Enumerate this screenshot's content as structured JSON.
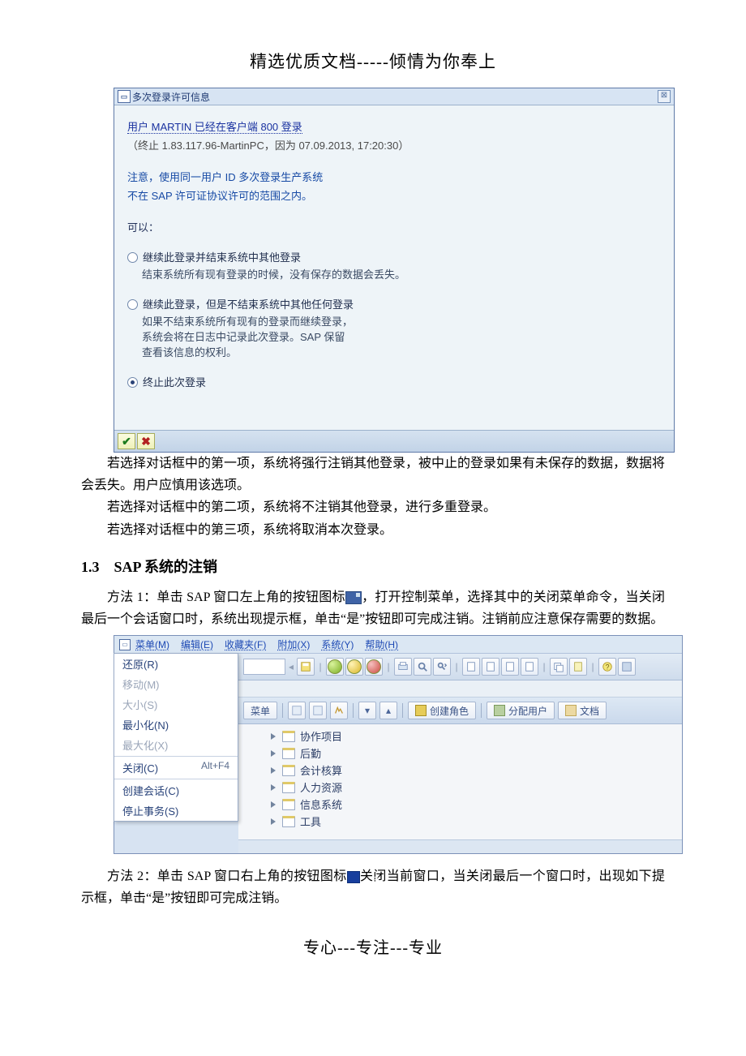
{
  "page_header": "精选优质文档-----倾情为你奉上",
  "page_footer": "专心---专注---专业",
  "dialog": {
    "title": "多次登录许可信息",
    "close_glyph": "⊠",
    "user_line_prefix": "用户 ",
    "user_name": "MARTIN",
    "user_line_mid": " 已经在客户端 ",
    "user_client": "800",
    "user_line_suffix": " 登录",
    "terminal_line": "（终止 1.83.117.96-MartinPC，因为 07.09.2013, 17:20:30）",
    "note1": "注意，使用同一用户 ID 多次登录生产系统",
    "note2": "不在 SAP 许可证协议许可的范围之内。",
    "can_label": "可以：",
    "option1": {
      "label": "继续此登录并结束系统中其他登录",
      "desc": "结束系统所有现有登录的时候，没有保存的数据会丢失。"
    },
    "option2": {
      "label": "继续此登录，但是不结束系统中其他任何登录",
      "desc1": "如果不结束系统所有现有的登录而继续登录，",
      "desc2": "系统会将在日志中记录此次登录。SAP 保留",
      "desc3": "查看该信息的权利。"
    },
    "option3": {
      "label": "终止此次登录"
    },
    "ok_glyph": "✔",
    "cancel_glyph": "✖"
  },
  "paras": {
    "p1": "若选择对话框中的第一项，系统将强行注销其他登录，被中止的登录如果有未保存的数据，数据将会丢失。用户应慎用该选项。",
    "p2": "若选择对话框中的第二项，系统将不注销其他登录，进行多重登录。",
    "p3": "若选择对话框中的第三项，系统将取消本次登录。",
    "h13": "1.3 SAP 系统的注销",
    "p4a": "方法 1：单击 SAP 窗口左上角的按钮图标",
    "p4b": "，打开控制菜单，选择其中的关闭菜单命令，当关闭最后一个会话窗口时，系统出现提示框，单击“是”按钮即可完成注销。注销前应注意保存需要的数据。",
    "p5a": "方法 2：单击 SAP 窗口右上角的按钮图标",
    "p5b": "关闭当前窗口，当关闭最后一个窗口时，出现如下提示框，单击“是”按钮即可完成注销。"
  },
  "sap_window": {
    "menubar": [
      "菜单(M)",
      "编辑(E)",
      "收藏夹(F)",
      "附加(X)",
      "系统(Y)",
      "帮助(H)"
    ],
    "context_menu": {
      "restore": "还原(R)",
      "move": "移动(M)",
      "size": "大小(S)",
      "minimize": "最小化(N)",
      "maximize": "最大化(X)",
      "close": "关闭(C)",
      "close_shortcut": "Alt+F4",
      "new_session": "创建会话(C)",
      "stop_trans": "停止事务(S)"
    },
    "secondary": {
      "menu_label": "菜单",
      "create_role": "创建角色",
      "assign_user": "分配用户",
      "document": "文档"
    },
    "tree": [
      "协作项目",
      "后勤",
      "会计核算",
      "人力资源",
      "信息系统",
      "工具"
    ]
  }
}
